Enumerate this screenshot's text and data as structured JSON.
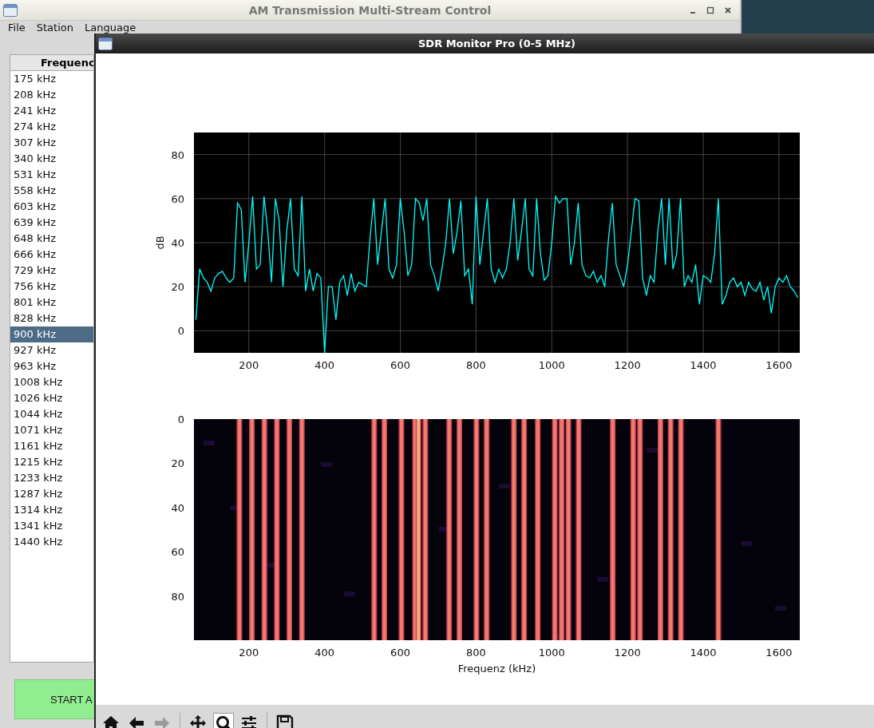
{
  "main_window": {
    "title": "AM Transmission Multi-Stream Control",
    "menu": [
      "File",
      "Station",
      "Language"
    ],
    "list": {
      "header": "Frequenc",
      "rows": [
        {
          "label": "175 kHz",
          "selected": false
        },
        {
          "label": "208 kHz",
          "selected": false
        },
        {
          "label": "241 kHz",
          "selected": false
        },
        {
          "label": "274 kHz",
          "selected": false
        },
        {
          "label": "307 kHz",
          "selected": false
        },
        {
          "label": "340 kHz",
          "selected": false
        },
        {
          "label": "531 kHz",
          "selected": false
        },
        {
          "label": "558 kHz",
          "selected": false
        },
        {
          "label": "603 kHz",
          "selected": false
        },
        {
          "label": "639 kHz",
          "selected": false
        },
        {
          "label": "648 kHz",
          "selected": false
        },
        {
          "label": "666 kHz",
          "selected": false
        },
        {
          "label": "729 kHz",
          "selected": false
        },
        {
          "label": "756 kHz",
          "selected": false
        },
        {
          "label": "801 kHz",
          "selected": false
        },
        {
          "label": "828 kHz",
          "selected": false
        },
        {
          "label": "900 kHz",
          "selected": true
        },
        {
          "label": "927 kHz",
          "selected": false
        },
        {
          "label": "963 kHz",
          "selected": false
        },
        {
          "label": "1008 kHz",
          "selected": false
        },
        {
          "label": "1026 kHz",
          "selected": false
        },
        {
          "label": "1044 kHz",
          "selected": false
        },
        {
          "label": "1071 kHz",
          "selected": false
        },
        {
          "label": "1161 kHz",
          "selected": false
        },
        {
          "label": "1215 kHz",
          "selected": false
        },
        {
          "label": "1233 kHz",
          "selected": false
        },
        {
          "label": "1287 kHz",
          "selected": false
        },
        {
          "label": "1314 kHz",
          "selected": false
        },
        {
          "label": "1341 kHz",
          "selected": false
        },
        {
          "label": "1440 kHz",
          "selected": false
        }
      ]
    },
    "start_button": "START A"
  },
  "monitor_window": {
    "title": "SDR Monitor Pro (0-5 MHz)",
    "spectrum": {
      "chart_data": {
        "type": "line",
        "ylabel": "dB",
        "xlim": [
          55,
          1655
        ],
        "ylim": [
          -10,
          90
        ],
        "xticks": [
          200,
          400,
          600,
          800,
          1000,
          1200,
          1400,
          1600
        ],
        "yticks": [
          0,
          20,
          40,
          60,
          80
        ],
        "x": [
          60,
          70,
          80,
          90,
          100,
          110,
          120,
          130,
          140,
          150,
          160,
          170,
          180,
          190,
          200,
          210,
          220,
          230,
          240,
          250,
          260,
          270,
          280,
          290,
          300,
          310,
          320,
          330,
          340,
          350,
          360,
          370,
          380,
          390,
          400,
          410,
          420,
          430,
          440,
          450,
          460,
          470,
          480,
          490,
          500,
          510,
          520,
          530,
          540,
          550,
          560,
          570,
          580,
          590,
          600,
          610,
          620,
          630,
          640,
          650,
          660,
          670,
          680,
          690,
          700,
          710,
          720,
          730,
          740,
          750,
          760,
          770,
          780,
          790,
          800,
          810,
          820,
          830,
          840,
          850,
          860,
          870,
          880,
          890,
          900,
          910,
          920,
          930,
          940,
          950,
          960,
          970,
          980,
          990,
          1000,
          1010,
          1020,
          1030,
          1040,
          1050,
          1060,
          1070,
          1080,
          1090,
          1100,
          1110,
          1120,
          1130,
          1140,
          1150,
          1160,
          1170,
          1180,
          1190,
          1200,
          1210,
          1220,
          1230,
          1240,
          1250,
          1260,
          1270,
          1280,
          1290,
          1300,
          1310,
          1320,
          1330,
          1340,
          1350,
          1360,
          1370,
          1380,
          1390,
          1400,
          1410,
          1420,
          1430,
          1440,
          1450,
          1460,
          1470,
          1480,
          1490,
          1500,
          1510,
          1520,
          1530,
          1540,
          1550,
          1560,
          1570,
          1580,
          1590,
          1600,
          1610,
          1620,
          1630,
          1640,
          1650
        ],
        "grid": true,
        "series": [
          {
            "color": "#00ffff",
            "values": [
              5,
              28,
              24,
              22,
              18,
              24,
              26,
              27,
              24,
              22,
              24,
              58,
              55,
              22,
              40,
              61,
              28,
              30,
              61,
              45,
              22,
              60,
              50,
              20,
              45,
              60,
              28,
              25,
              61,
              18,
              28,
              18,
              26,
              24,
              -10,
              20,
              20,
              5,
              22,
              25,
              16,
              26,
              18,
              22,
              21,
              20,
              42,
              60,
              30,
              45,
              60,
              28,
              24,
              30,
              60,
              45,
              25,
              30,
              60,
              58,
              50,
              60,
              30,
              25,
              18,
              28,
              40,
              60,
              35,
              45,
              59,
              25,
              28,
              12,
              61,
              30,
              45,
              60,
              28,
              22,
              28,
              24,
              28,
              40,
              60,
              32,
              45,
              60,
              28,
              25,
              60,
              35,
              23,
              25,
              40,
              61,
              58,
              60,
              60,
              30,
              40,
              58,
              30,
              25,
              24,
              27,
              22,
              25,
              20,
              42,
              58,
              30,
              25,
              20,
              30,
              45,
              60,
              59,
              24,
              16,
              25,
              22,
              45,
              60,
              30,
              60,
              28,
              35,
              60,
              20,
              25,
              22,
              30,
              12,
              25,
              24,
              22,
              35,
              60,
              12,
              16,
              22,
              24,
              20,
              22,
              16,
              22,
              19,
              18,
              22,
              14,
              20,
              8,
              20,
              24,
              22,
              25,
              20,
              18,
              15
            ]
          }
        ]
      }
    },
    "waterfall": {
      "xlabel": "Frequenz (kHz)",
      "xtick_labels": [
        "200",
        "400",
        "600",
        "800",
        "1000",
        "1200",
        "1400",
        "1600"
      ],
      "ytick_labels": [
        "0",
        "20",
        "40",
        "60",
        "80"
      ]
    },
    "toolbar": [
      {
        "kind": "home",
        "disabled": false,
        "selected": false
      },
      {
        "kind": "back",
        "disabled": false,
        "selected": false
      },
      {
        "kind": "forward",
        "disabled": true,
        "selected": false
      },
      {
        "kind": "pan",
        "disabled": false,
        "selected": false
      },
      {
        "kind": "zoom",
        "disabled": false,
        "selected": true
      },
      {
        "kind": "configure",
        "disabled": false,
        "selected": false
      },
      {
        "kind": "save",
        "disabled": false,
        "selected": false
      }
    ]
  }
}
